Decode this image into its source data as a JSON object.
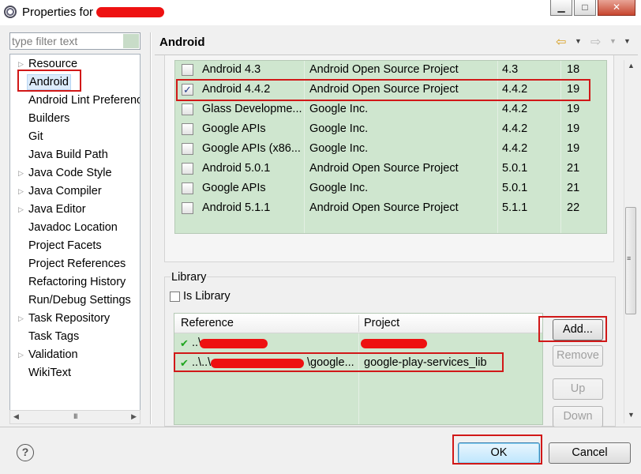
{
  "window": {
    "title": "Properties for",
    "buttons": {
      "minimize": "▁",
      "maximize": "□",
      "close": "✕"
    }
  },
  "filter": {
    "placeholder": "type filter text",
    "value": ""
  },
  "tree": {
    "items": [
      {
        "label": "Resource",
        "expandable": true
      },
      {
        "label": "Android",
        "expandable": false,
        "selected": true
      },
      {
        "label": "Android Lint Preferences",
        "expandable": false
      },
      {
        "label": "Builders",
        "expandable": false
      },
      {
        "label": "Git",
        "expandable": false
      },
      {
        "label": "Java Build Path",
        "expandable": false
      },
      {
        "label": "Java Code Style",
        "expandable": true
      },
      {
        "label": "Java Compiler",
        "expandable": true
      },
      {
        "label": "Java Editor",
        "expandable": true
      },
      {
        "label": "Javadoc Location",
        "expandable": false
      },
      {
        "label": "Project Facets",
        "expandable": false
      },
      {
        "label": "Project References",
        "expandable": false
      },
      {
        "label": "Refactoring History",
        "expandable": false
      },
      {
        "label": "Run/Debug Settings",
        "expandable": false
      },
      {
        "label": "Task Repository",
        "expandable": true
      },
      {
        "label": "Task Tags",
        "expandable": false
      },
      {
        "label": "Validation",
        "expandable": true
      },
      {
        "label": "WikiText",
        "expandable": false
      }
    ],
    "scroll_grip": "III"
  },
  "page": {
    "title": "Android"
  },
  "targets": {
    "rows": [
      {
        "name": "Android 4.3",
        "vendor": "Android Open Source Project",
        "platform": "4.3",
        "api": "18",
        "checked": false
      },
      {
        "name": "Android 4.4.2",
        "vendor": "Android Open Source Project",
        "platform": "4.4.2",
        "api": "19",
        "checked": true
      },
      {
        "name": "Glass Developme...",
        "vendor": "Google Inc.",
        "platform": "4.4.2",
        "api": "19",
        "checked": false
      },
      {
        "name": "Google APIs",
        "vendor": "Google Inc.",
        "platform": "4.4.2",
        "api": "19",
        "checked": false
      },
      {
        "name": "Google APIs (x86...",
        "vendor": "Google Inc.",
        "platform": "4.4.2",
        "api": "19",
        "checked": false
      },
      {
        "name": "Android 5.0.1",
        "vendor": "Android Open Source Project",
        "platform": "5.0.1",
        "api": "21",
        "checked": false
      },
      {
        "name": "Google APIs",
        "vendor": "Google Inc.",
        "platform": "5.0.1",
        "api": "21",
        "checked": false
      },
      {
        "name": "Android 5.1.1",
        "vendor": "Android Open Source Project",
        "platform": "5.1.1",
        "api": "22",
        "checked": false
      }
    ]
  },
  "library": {
    "group_label": "Library",
    "is_library_label": "Is Library",
    "columns": {
      "reference": "Reference",
      "project": "Project"
    },
    "rows": [
      {
        "reference": "..\\",
        "project": ""
      },
      {
        "reference": "..\\..\\",
        "reference_suffix": "\\google...",
        "project": "google-play-services_lib"
      }
    ],
    "buttons": {
      "add": "Add...",
      "remove": "Remove",
      "up": "Up",
      "down": "Down"
    }
  },
  "footer": {
    "help": "?",
    "ok": "OK",
    "cancel": "Cancel"
  }
}
